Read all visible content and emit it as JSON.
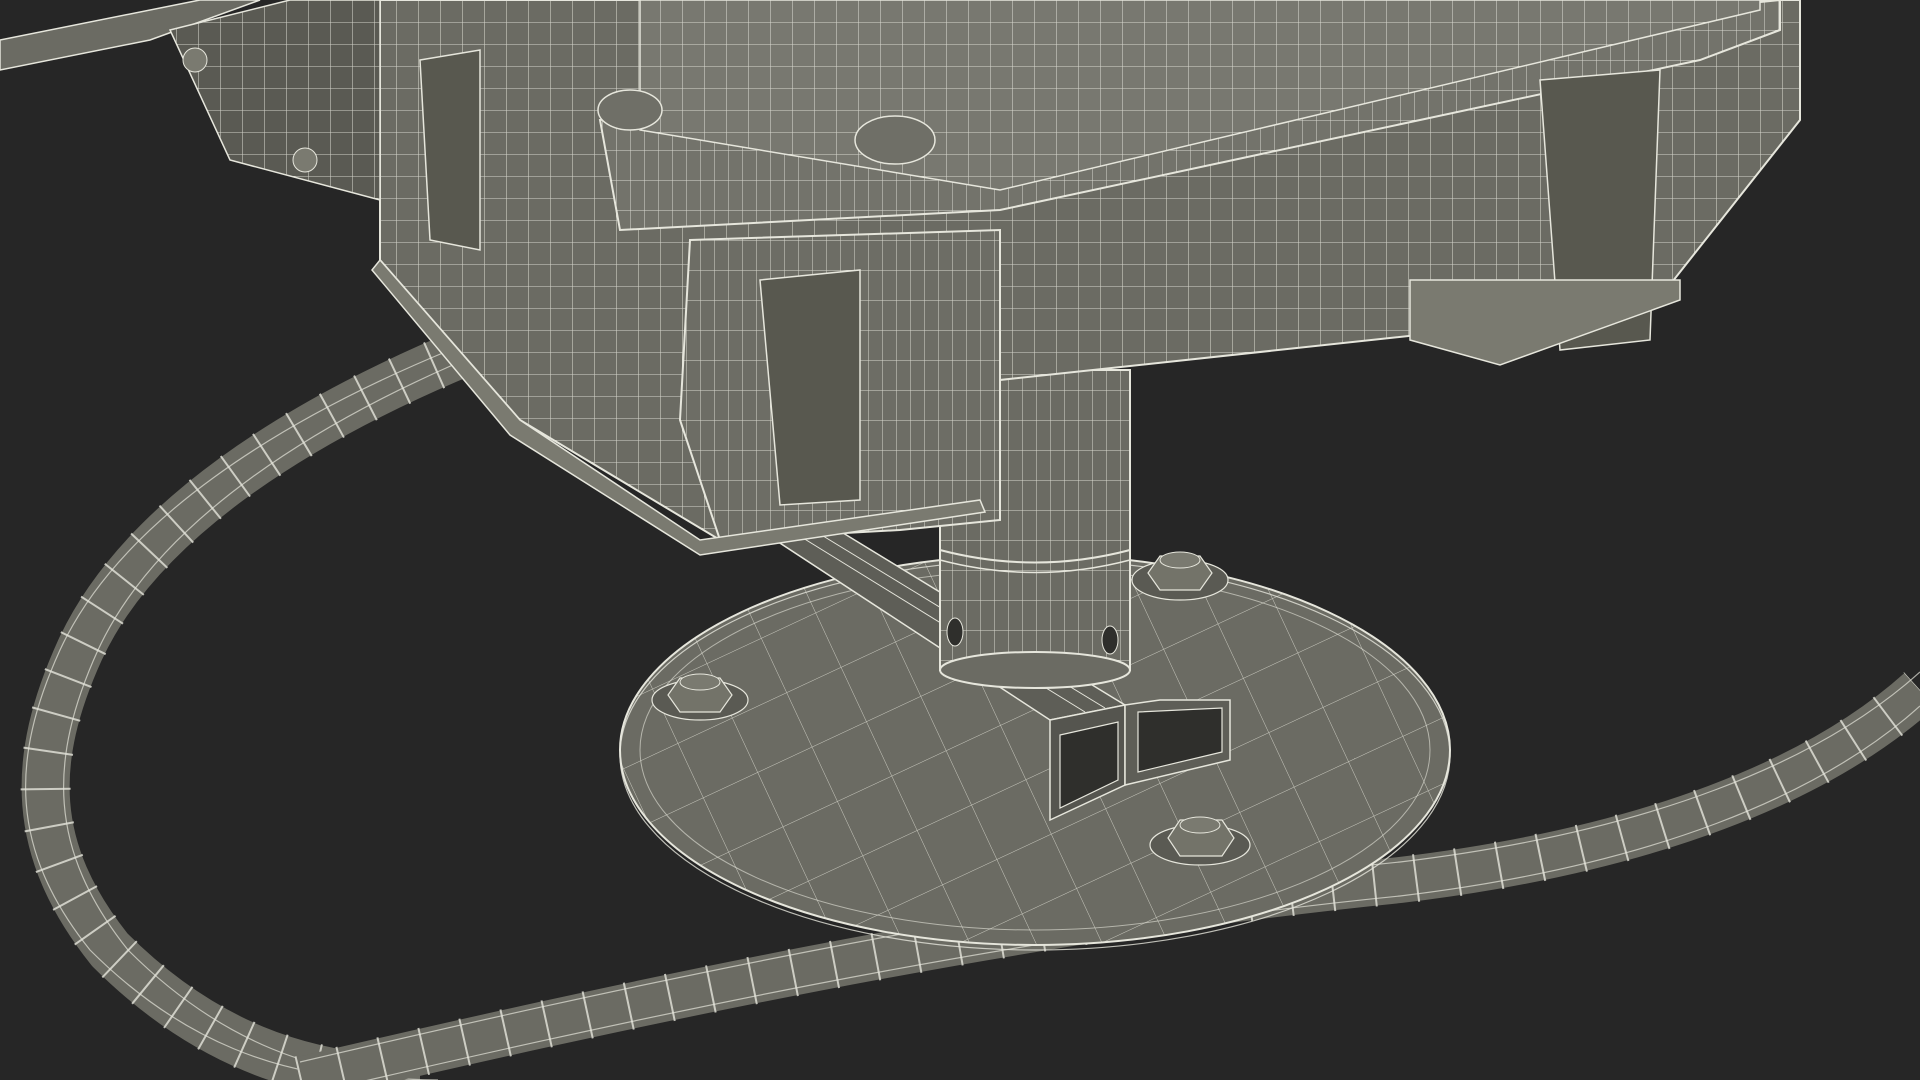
{
  "scene": {
    "background_color": "#262626",
    "surface_color": "#6b6b63",
    "wire_color": "#e6e6dc",
    "shadow_color": "#4a4a44",
    "objects": [
      "cable",
      "round-base-plate",
      "rectangular-bracket",
      "mounting-bolts",
      "vertical-post",
      "enclosure-housing"
    ]
  }
}
